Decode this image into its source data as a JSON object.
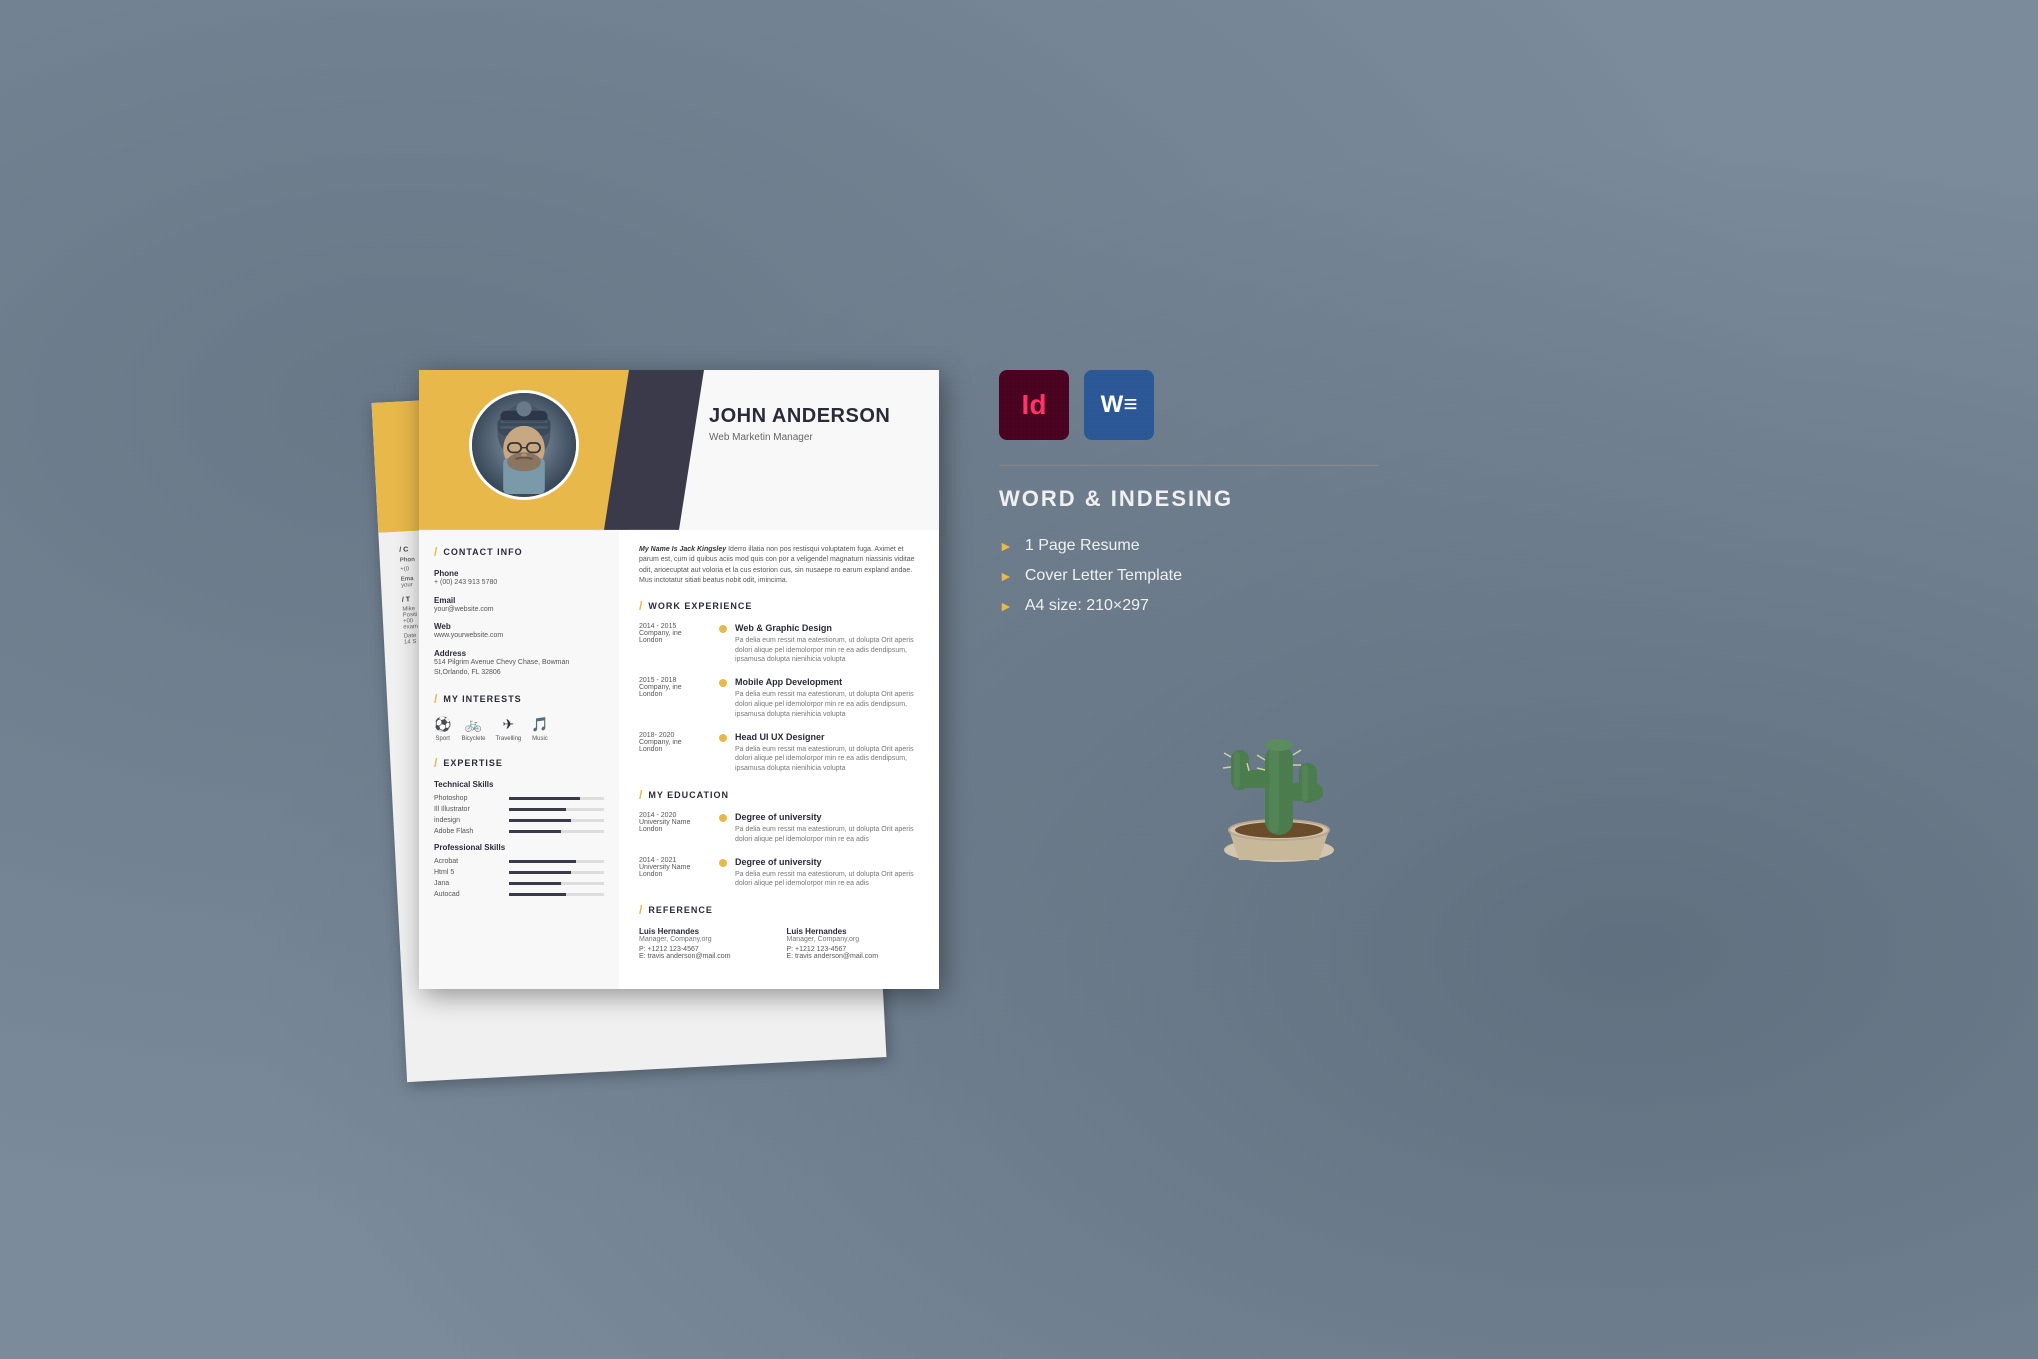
{
  "page": {
    "background_color": "#7a8a9a"
  },
  "software_labels": {
    "indesign": "Id",
    "word": "W",
    "title": "WORD & INDESING"
  },
  "features": [
    "1 Page Resume",
    "Cover Letter Template",
    "A4 size: 210×297"
  ],
  "resume": {
    "name": "JOHN ANDERSON",
    "title": "Web Marketin Manager",
    "profile_italic": "My Name Is Jack Kingsley",
    "profile_text": " Iderro illatia non pos restisqui voluptatem fuga. Aximet et parum est, cum id quibus aciis mod quis con por a veligendel magnaturn niassinis viditae odit, arioecuptat aut voloria et la cus estorion cus, sin nusaepe ro earum expland andae. Mus inctotatur sitiati beatus nobit odit, imincima.",
    "contact": {
      "title": "CONTACT INFO",
      "phone_label": "Phone",
      "phone_value": "+ (00) 243 913 5780",
      "email_label": "Email",
      "email_value": "your@website.com",
      "web_label": "Web",
      "web_value": "www.yourwebsite.com",
      "address_label": "Address",
      "address_value": "514 Pilgrim Avenue Chevy Chase, Bowman St,Orlando, FL 32806"
    },
    "interests": {
      "title": "MY INTERESTS",
      "items": [
        {
          "icon": "⚽",
          "label": "Sport"
        },
        {
          "icon": "🚲",
          "label": "Bicyclete"
        },
        {
          "icon": "✈",
          "label": "Travelling"
        },
        {
          "icon": "🎵",
          "label": "Music"
        }
      ]
    },
    "expertise": {
      "title": "EXPERTISE",
      "technical": {
        "label": "Technical Skills",
        "skills": [
          {
            "name": "Photoshop",
            "percent": 75
          },
          {
            "name": "Ill Illustrator",
            "percent": 60
          },
          {
            "name": "indesign",
            "percent": 65
          },
          {
            "name": "Adobe Flash",
            "percent": 55
          }
        ]
      },
      "professional": {
        "label": "Professional Skills",
        "skills": [
          {
            "name": "Acrobat",
            "percent": 70
          },
          {
            "name": "Html 5",
            "percent": 65
          },
          {
            "name": "Jana",
            "percent": 55
          },
          {
            "name": "Autocad",
            "percent": 60
          }
        ]
      }
    },
    "work_experience": {
      "title": "WORK EXPERIENCE",
      "items": [
        {
          "date": "2014 - 2015",
          "company": "Company, ine\nLondon",
          "job_title": "Web & Graphic Design",
          "description": "Pa delia eum ressit ma eatestiorum, ut dolupta Orit aperis dolori alique pel idemolorpor min re ea adis dendipsum, ipsamusa dolupta nienihicia volupta"
        },
        {
          "date": "2015 - 2018",
          "company": "Company, ine\nLondon",
          "job_title": "Mobile App Development",
          "description": "Pa delia eum ressit ma eatestiorum, ut dolupta Orit aperis dolori alique pel idemolorpor min re ea adis dendipsum, ipsamusa dolupta nienihicia volupta"
        },
        {
          "date": "2018- 2020",
          "company": "Company, ine\nLondon",
          "job_title": "Head UI UX Designer",
          "description": "Pa delia eum ressit ma eatestiorum, ut dolupta Orit aperis dolori alique pel idemolorpor min re ea adis dendipsum, ipsamusa dolupta nienihicia volupta"
        }
      ]
    },
    "education": {
      "title": "MY EDUCATION",
      "items": [
        {
          "date": "2014 - 2020",
          "institution": "University Name\nLondon",
          "degree": "Degree of university",
          "description": "Pa delia eum ressit ma eatestiorum, ut dolupta Orit aperis dolori alique pel idemolorpor min re ea adis"
        },
        {
          "date": "2014 - 2021",
          "institution": "University Name\nLondon",
          "degree": "Degree of university",
          "description": "Pa delia eum ressit ma eatestiorum, ut dolupta Orit aperis dolori alique pel idemolorpor min re ea adis"
        }
      ]
    },
    "reference": {
      "title": "REFERENCE",
      "items": [
        {
          "name": "Luis Hernandes",
          "position": "Manager, Company,org",
          "phone": "P: +1212 123-4567",
          "email": "E: travis anderson@mail.com"
        },
        {
          "name": "Luis Hernandes",
          "position": "Manager, Company,org",
          "phone": "P: +1212 123-4567",
          "email": "E: travis anderson@mail.com"
        }
      ]
    }
  }
}
